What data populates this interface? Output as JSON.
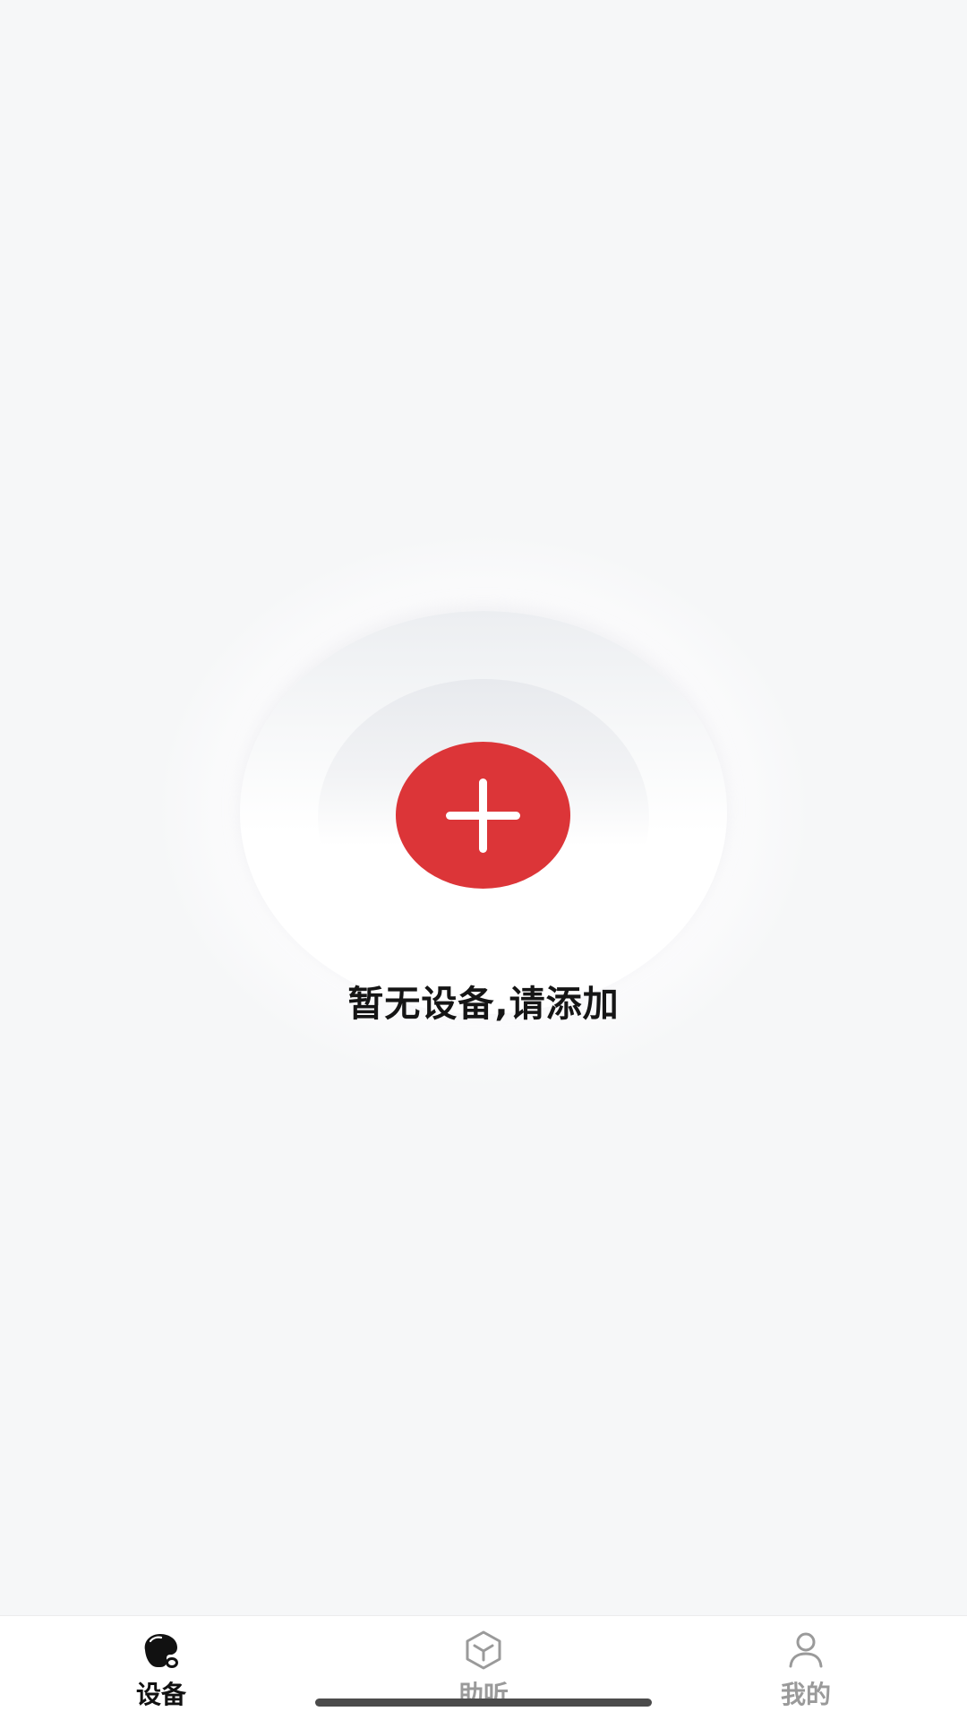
{
  "empty_state": {
    "message": "暂无设备,请添加",
    "add_button_icon": "plus-icon",
    "accent_color": "#dc3538"
  },
  "tabs": [
    {
      "label": "设备",
      "icon": "hearing-aid-icon",
      "active": true
    },
    {
      "label": "助听",
      "icon": "cube-icon",
      "active": false
    },
    {
      "label": "我的",
      "icon": "person-icon",
      "active": false
    }
  ],
  "colors": {
    "background": "#f6f7f8",
    "active_tab": "#111111",
    "inactive_tab": "#9a9a9a"
  }
}
